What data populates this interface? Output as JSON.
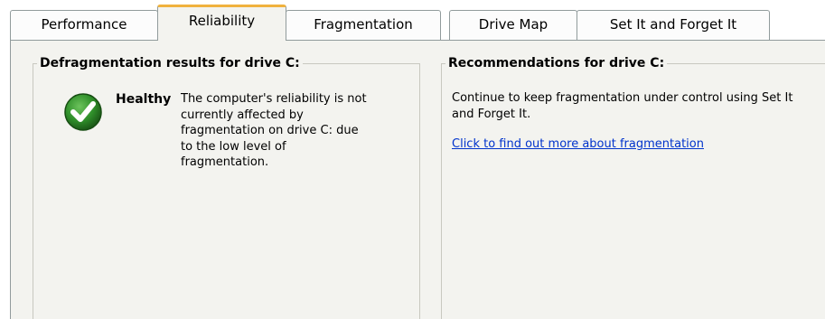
{
  "tabs": [
    {
      "label": "Performance"
    },
    {
      "label": "Reliability"
    },
    {
      "label": "Fragmentation"
    },
    {
      "label": "Drive Map"
    },
    {
      "label": "Set It and Forget It"
    }
  ],
  "active_tab": "Reliability",
  "left_group": {
    "title": "Defragmentation results for drive C:",
    "status_icon": "check-icon",
    "status_color": "#2f8f2a",
    "status_label": "Healthy",
    "status_text": "The computer's reliability is not currently affected by fragmentation on drive C: due to the low level of fragmentation."
  },
  "right_group": {
    "title": "Recommendations for drive C:",
    "text": "Continue to keep fragmentation under control using Set It and Forget It.",
    "link_text": "Click to find out more about fragmentation"
  },
  "colors": {
    "active_tab_accent": "#f0b23e",
    "panel_background": "#f3f3ef",
    "link": "#0033cc"
  }
}
